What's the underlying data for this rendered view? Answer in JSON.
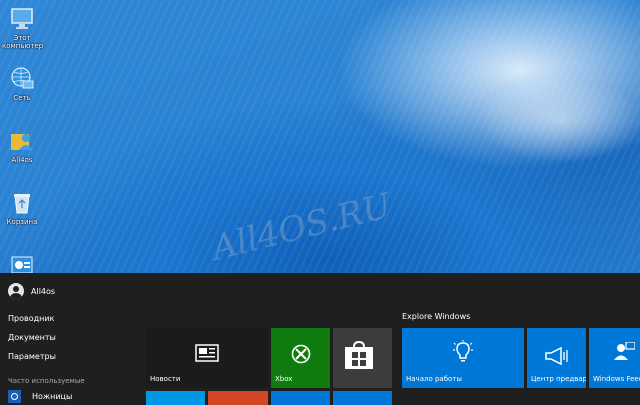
{
  "desktop": {
    "icons": [
      {
        "label": "Этот компьютер",
        "icon": "computer-icon"
      },
      {
        "label": "Сеть",
        "icon": "network-globe-icon"
      },
      {
        "label": "All4os",
        "icon": "user-folder-icon"
      },
      {
        "label": "Корзина",
        "icon": "recycle-bin-icon"
      },
      {
        "label": "",
        "icon": "control-panel-icon"
      }
    ]
  },
  "watermark": "All4OS.RU",
  "start": {
    "user": "All4os",
    "links": [
      "Проводник",
      "Документы",
      "Параметры"
    ],
    "frequent_title": "Часто используемые",
    "frequent_apps": [
      {
        "label": "Ножницы",
        "icon": "scissors-icon"
      }
    ],
    "tiles": {
      "news": "Новости",
      "xbox": "Xbox",
      "store": "",
      "explore_title": "Explore Windows",
      "getting_started": "Начало работы",
      "notification_center": "Центр предвар",
      "feedback": "Windows Feed"
    }
  },
  "colors": {
    "start_bg": "#1f1f1f",
    "news": "#1b1b1b",
    "xbox": "#107c10",
    "store": "#3c3c3c",
    "blue_tile": "#0078d7",
    "orange_tile": "#d24726"
  }
}
